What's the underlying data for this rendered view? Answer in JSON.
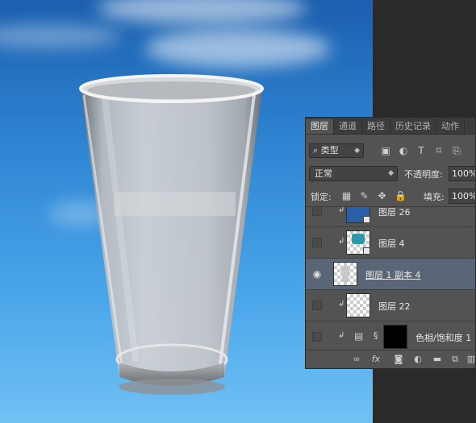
{
  "panel": {
    "tabs": [
      "图层",
      "通道",
      "路径",
      "历史记录",
      "动作"
    ],
    "filter_label": "类型",
    "blend_mode": "正常",
    "opacity_label": "不透明度:",
    "opacity_value": "100%",
    "lock_label": "锁定:",
    "fill_label": "填充:",
    "fill_value": "100%"
  },
  "layers": [
    {
      "name": "图层 26",
      "visible": false,
      "clipped": true,
      "selected": false
    },
    {
      "name": "图层 4",
      "visible": false,
      "clipped": true,
      "selected": false
    },
    {
      "name": "图层 1 副本 4",
      "visible": true,
      "clipped": false,
      "selected": true
    },
    {
      "name": "图层 22",
      "visible": false,
      "clipped": true,
      "selected": false
    },
    {
      "name": "色相/饱和度 1",
      "visible": false,
      "clipped": true,
      "selected": false
    }
  ],
  "footer_icons": [
    "link-icon",
    "fx-icon",
    "mask-icon",
    "adjustment-icon",
    "folder-icon",
    "new-layer-icon",
    "trash-icon"
  ],
  "colors": {
    "selected_row": "#5a6577",
    "panel_bg": "#535353",
    "sky_top": "#1b5fae",
    "sky_bottom": "#70c1f3"
  }
}
